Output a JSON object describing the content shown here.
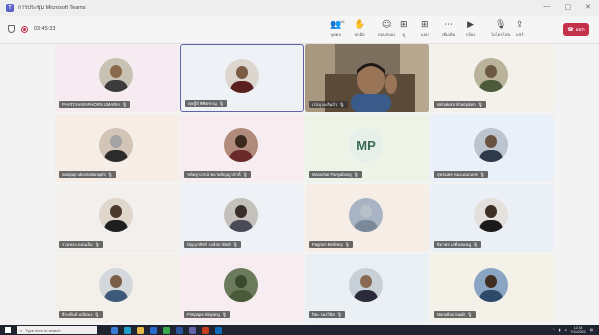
{
  "window": {
    "title": "การประชุม Microsoft Teams",
    "ctrl_min": "—",
    "ctrl_max": "▢",
    "ctrl_close": "✕"
  },
  "toolbar": {
    "timer": "03:45:33",
    "buttons": [
      {
        "label": "บุคคล",
        "icon": "people-icon",
        "glyph": "👥",
        "badge": "16"
      },
      {
        "label": "ยกมือ",
        "icon": "raise-hand-icon",
        "glyph": "✋"
      },
      {
        "label": "ตอบสนอง",
        "icon": "reactions-icon",
        "glyph": "☺"
      },
      {
        "label": "ดู",
        "icon": "view-icon",
        "glyph": "⊞"
      },
      {
        "label": "แอป",
        "icon": "apps-icon",
        "glyph": "⊞"
      },
      {
        "label": "เพิ่มเติม",
        "icon": "more-icon",
        "glyph": "⋯"
      },
      {
        "label": "กล้อง",
        "icon": "camera-icon",
        "glyph": "▶"
      },
      {
        "label": "ไมโครโฟน",
        "icon": "microphone-icon",
        "glyph": "🎙"
      },
      {
        "label": "แชร์",
        "icon": "share-icon",
        "glyph": "⇪"
      }
    ],
    "leave_label": "ออก"
  },
  "participants": [
    {
      "name": "PHATCHARAPHORN UMARIA",
      "bg": "#f5ebf1",
      "skin": "#8a6a4d",
      "shirt": "#3b3b3b",
      "avbg": "#c8c2b4"
    },
    {
      "name": "ดุษฎีย์ พิชิตชาญ",
      "bg": "#eef2f6",
      "skin": "#7a5a42",
      "shirt": "#5a2020",
      "avbg": "#ddd6cf",
      "active": true
    },
    {
      "name": "ภาณุ มะลิแก้ว",
      "bg": "#6b5f50",
      "video": true
    },
    {
      "name": "sirinakorn khamplum",
      "bg": "#f4f1ea",
      "skin": "#6d5845",
      "shirt": "#4a5a3a",
      "avbg": "#b8b39a"
    },
    {
      "name": "sasipap ubonrattanaphi",
      "bg": "#f6ede6",
      "skin": "#a3a3a3",
      "shirt": "#2b2b2b",
      "avbg": "#d2c4b6"
    },
    {
      "name": "ขนิษฐาภรณ์ พลายตัญญูวภักดิ์",
      "bg": "#f7ecef",
      "skin": "#3a2a1e",
      "shirt": "#6b2a2a",
      "avbg": "#b08a7a"
    },
    {
      "name": "Marachai Panyabung",
      "bg": "#eef3e8",
      "initials": "MP"
    },
    {
      "name": "สุทธนพร ทองเอนกเดช",
      "bg": "#e9f0f7",
      "skin": "#6a5240",
      "shirt": "#2e3a4a",
      "avbg": "#bcc4cf"
    },
    {
      "name": "รวมทอง ดอนเอ็ม",
      "bg": "#f2f0ed",
      "skin": "#4a3a2e",
      "shirt": "#1e1e1e",
      "avbg": "#e0d7cc"
    },
    {
      "name": "ปัญญาพัชร์ วงษ์สถาปัตย์",
      "bg": "#eef1f5",
      "skin": "#3a2e28",
      "shirt": "#4a4a58",
      "avbg": "#c4c0bc"
    },
    {
      "name": "Pagrom Berlisey",
      "bg": "#f5ede6",
      "skin": "#b8c0c8",
      "shirt": "#7a8a9a",
      "avbg": "#a8b4c4"
    },
    {
      "name": "ธิดาพร เลยื่นชอฉมู",
      "bg": "#eaf0f6",
      "skin": "#3e2e24",
      "shirt": "#1a1a1a",
      "avbg": "#e4e0dc"
    },
    {
      "name": "ธีระพันธ์ มณีทอง",
      "bg": "#f3f0ea",
      "skin": "#7a5e48",
      "shirt": "#3e5a7a",
      "avbg": "#d4d8dc"
    },
    {
      "name": "Pimpapa Klayang",
      "bg": "#f7ecf0",
      "skin": "#3a4a2e",
      "shirt": "#4a5a3a",
      "avbg": "#6a7a5a"
    },
    {
      "name": "ปิยะ รองวิจิต",
      "bg": "#eaf0f3",
      "skin": "#8a6a52",
      "shirt": "#2a2a3a",
      "avbg": "#c8d0d8"
    },
    {
      "name": "Nanuthai Saalit",
      "bg": "#f4f2e8",
      "skin": "#3e2e24",
      "shirt": "#2e4a6a",
      "avbg": "#8aa4c4"
    }
  ],
  "taskbar": {
    "search_placeholder": "Type here to search",
    "time": "12:34",
    "date": "7/11/2022"
  },
  "colors": {
    "accent": "#6264a7",
    "leave": "#c4314b"
  }
}
